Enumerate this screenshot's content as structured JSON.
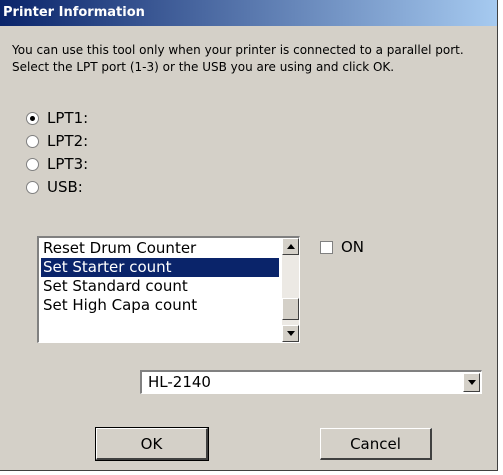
{
  "window": {
    "title": "Printer Information"
  },
  "description": {
    "line1": "You can use this tool only when your printer is connected to a parallel port.",
    "line2": "Select the LPT port (1-3) or the USB you are using and click OK."
  },
  "ports": [
    {
      "label": "LPT1:",
      "checked": true
    },
    {
      "label": "LPT2:",
      "checked": false
    },
    {
      "label": "LPT3:",
      "checked": false
    },
    {
      "label": "USB:",
      "checked": false
    }
  ],
  "list": {
    "items": [
      {
        "label": "Reset Drum Counter",
        "selected": false
      },
      {
        "label": "Set Starter count",
        "selected": true
      },
      {
        "label": "Set Standard count",
        "selected": false
      },
      {
        "label": "Set High Capa count",
        "selected": false
      }
    ]
  },
  "on_checkbox": {
    "label": "ON",
    "checked": false
  },
  "model_select": {
    "value": "HL-2140"
  },
  "buttons": {
    "ok": "OK",
    "cancel": "Cancel"
  }
}
